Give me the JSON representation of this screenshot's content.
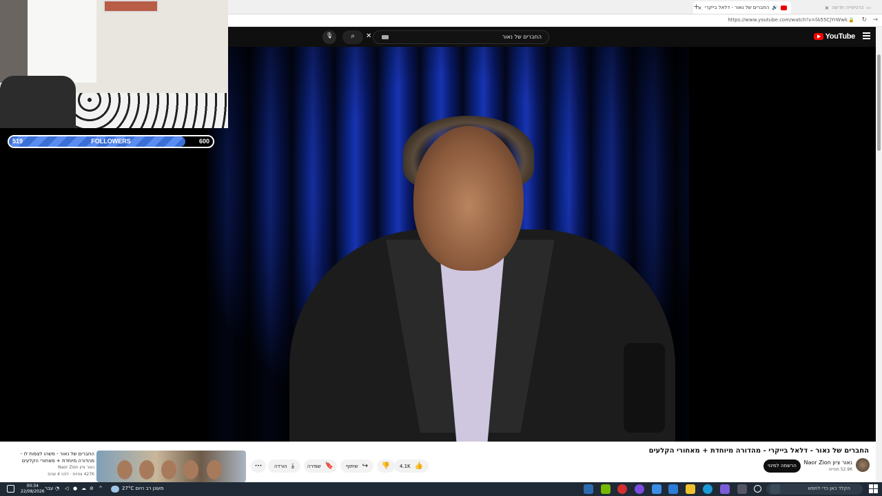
{
  "browser": {
    "tabs": [
      {
        "label": "החברים של נאור - דלאל בייקרי",
        "active": true
      },
      {
        "label": "כרטיסייה חדשה",
        "active": false
      }
    ],
    "new_tab_glyph": "+",
    "close_glyph": "×",
    "url": "https://www.youtube.com/watch?v=fA55CjYrWwk"
  },
  "youtube": {
    "logo_text": "YouTube",
    "search_query": "החברים של נאור",
    "clear_glyph": "✕",
    "search_glyph": "⌕",
    "mic_glyph": "🎙"
  },
  "stream_overlay": {
    "followers_label": "FOLLOWERS",
    "followers_current": "519",
    "followers_goal": "600",
    "followers_progress": 0.865
  },
  "video": {
    "title": "החברים של נאור - דלאל בייקרי - מהדורה מיוחדת + מאחורי הקלעים",
    "channel_name": "נאור ציון Naor Zion",
    "channel_subs": "52.9K מנויים",
    "subscribe_label": "הרשמה למינוי",
    "like_count": "4.1K",
    "like_glyph": "👍",
    "dislike_glyph": "👎",
    "share_label": "שיתוף",
    "share_glyph": "↪",
    "save_label": "שמירה",
    "save_glyph": "🔖",
    "download_label": "הורדה",
    "download_glyph": "⤓",
    "more_glyph": "•••"
  },
  "recommendation": {
    "title": "החברים של נאור - משהו לצפות לו - מהדורה מיוחדת + מאחורי הקלעים",
    "channel": "נאור ציון Naor Zion",
    "meta": "427K צפיות · לפני 4 שנים"
  },
  "taskbar": {
    "search_placeholder": "הקלד כאן כדי לחפש",
    "weather": "27°C  מעונן רב היום",
    "language": "עבר",
    "time": "00:34",
    "date": "22/08/2026"
  }
}
